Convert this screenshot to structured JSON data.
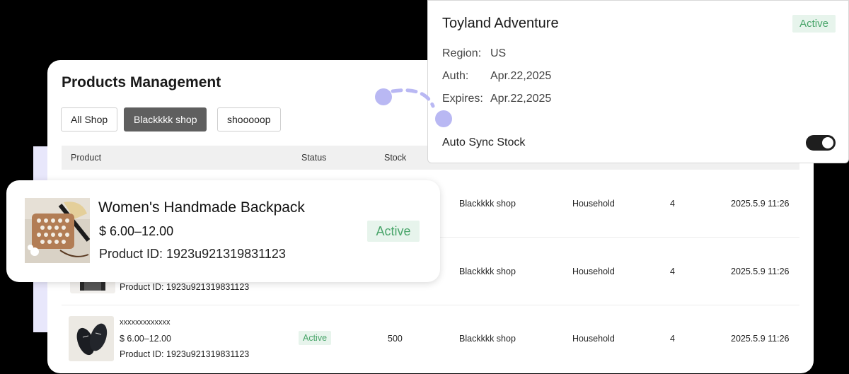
{
  "main": {
    "title": "Products Management",
    "shop_tabs": [
      {
        "label": "All Shop",
        "selected": false
      },
      {
        "label": "Blackkkk shop",
        "selected": true
      },
      {
        "label": "shooooop",
        "selected": false
      }
    ],
    "columns": [
      "Product",
      "Status",
      "Stock"
    ],
    "rows": [
      {
        "shop": "Blackkkk shop",
        "category": "Household",
        "count": "4",
        "time": "2025.5.9 11:26"
      },
      {
        "product_id": "Product ID: 1923u921319831123",
        "shop": "Blackkkk shop",
        "category": "Household",
        "count": "4",
        "time": "2025.5.9 11:26"
      },
      {
        "name": "xxxxxxxxxxxxx",
        "price": "$ 6.00–12.00",
        "product_id": "Product ID: 1923u921319831123",
        "status": "Active",
        "stock": "500",
        "shop": "Blackkkk shop",
        "category": "Household",
        "count": "4",
        "time": "2025.5.9 11:26"
      }
    ]
  },
  "product_card": {
    "name": "Women's Handmade Backpack",
    "price": "$ 6.00–12.00",
    "product_id": "Product ID: 1923u921319831123",
    "status": "Active"
  },
  "store_popup": {
    "title": "Toyland Adventure",
    "status": "Active",
    "region_label": "Region:",
    "region_value": "US",
    "auth_label": "Auth:",
    "auth_value": "Apr.22,2025",
    "expires_label": "Expires:",
    "expires_value": "Apr.22,2025",
    "auto_sync_label": "Auto Sync Stock",
    "auto_sync_on": true
  },
  "colors": {
    "background": "#000000",
    "accent_lavender": "#b9b8f3",
    "active_green": "#49a56a",
    "active_bg": "#e7f4ec",
    "selected_tab": "#5f5f5f"
  }
}
